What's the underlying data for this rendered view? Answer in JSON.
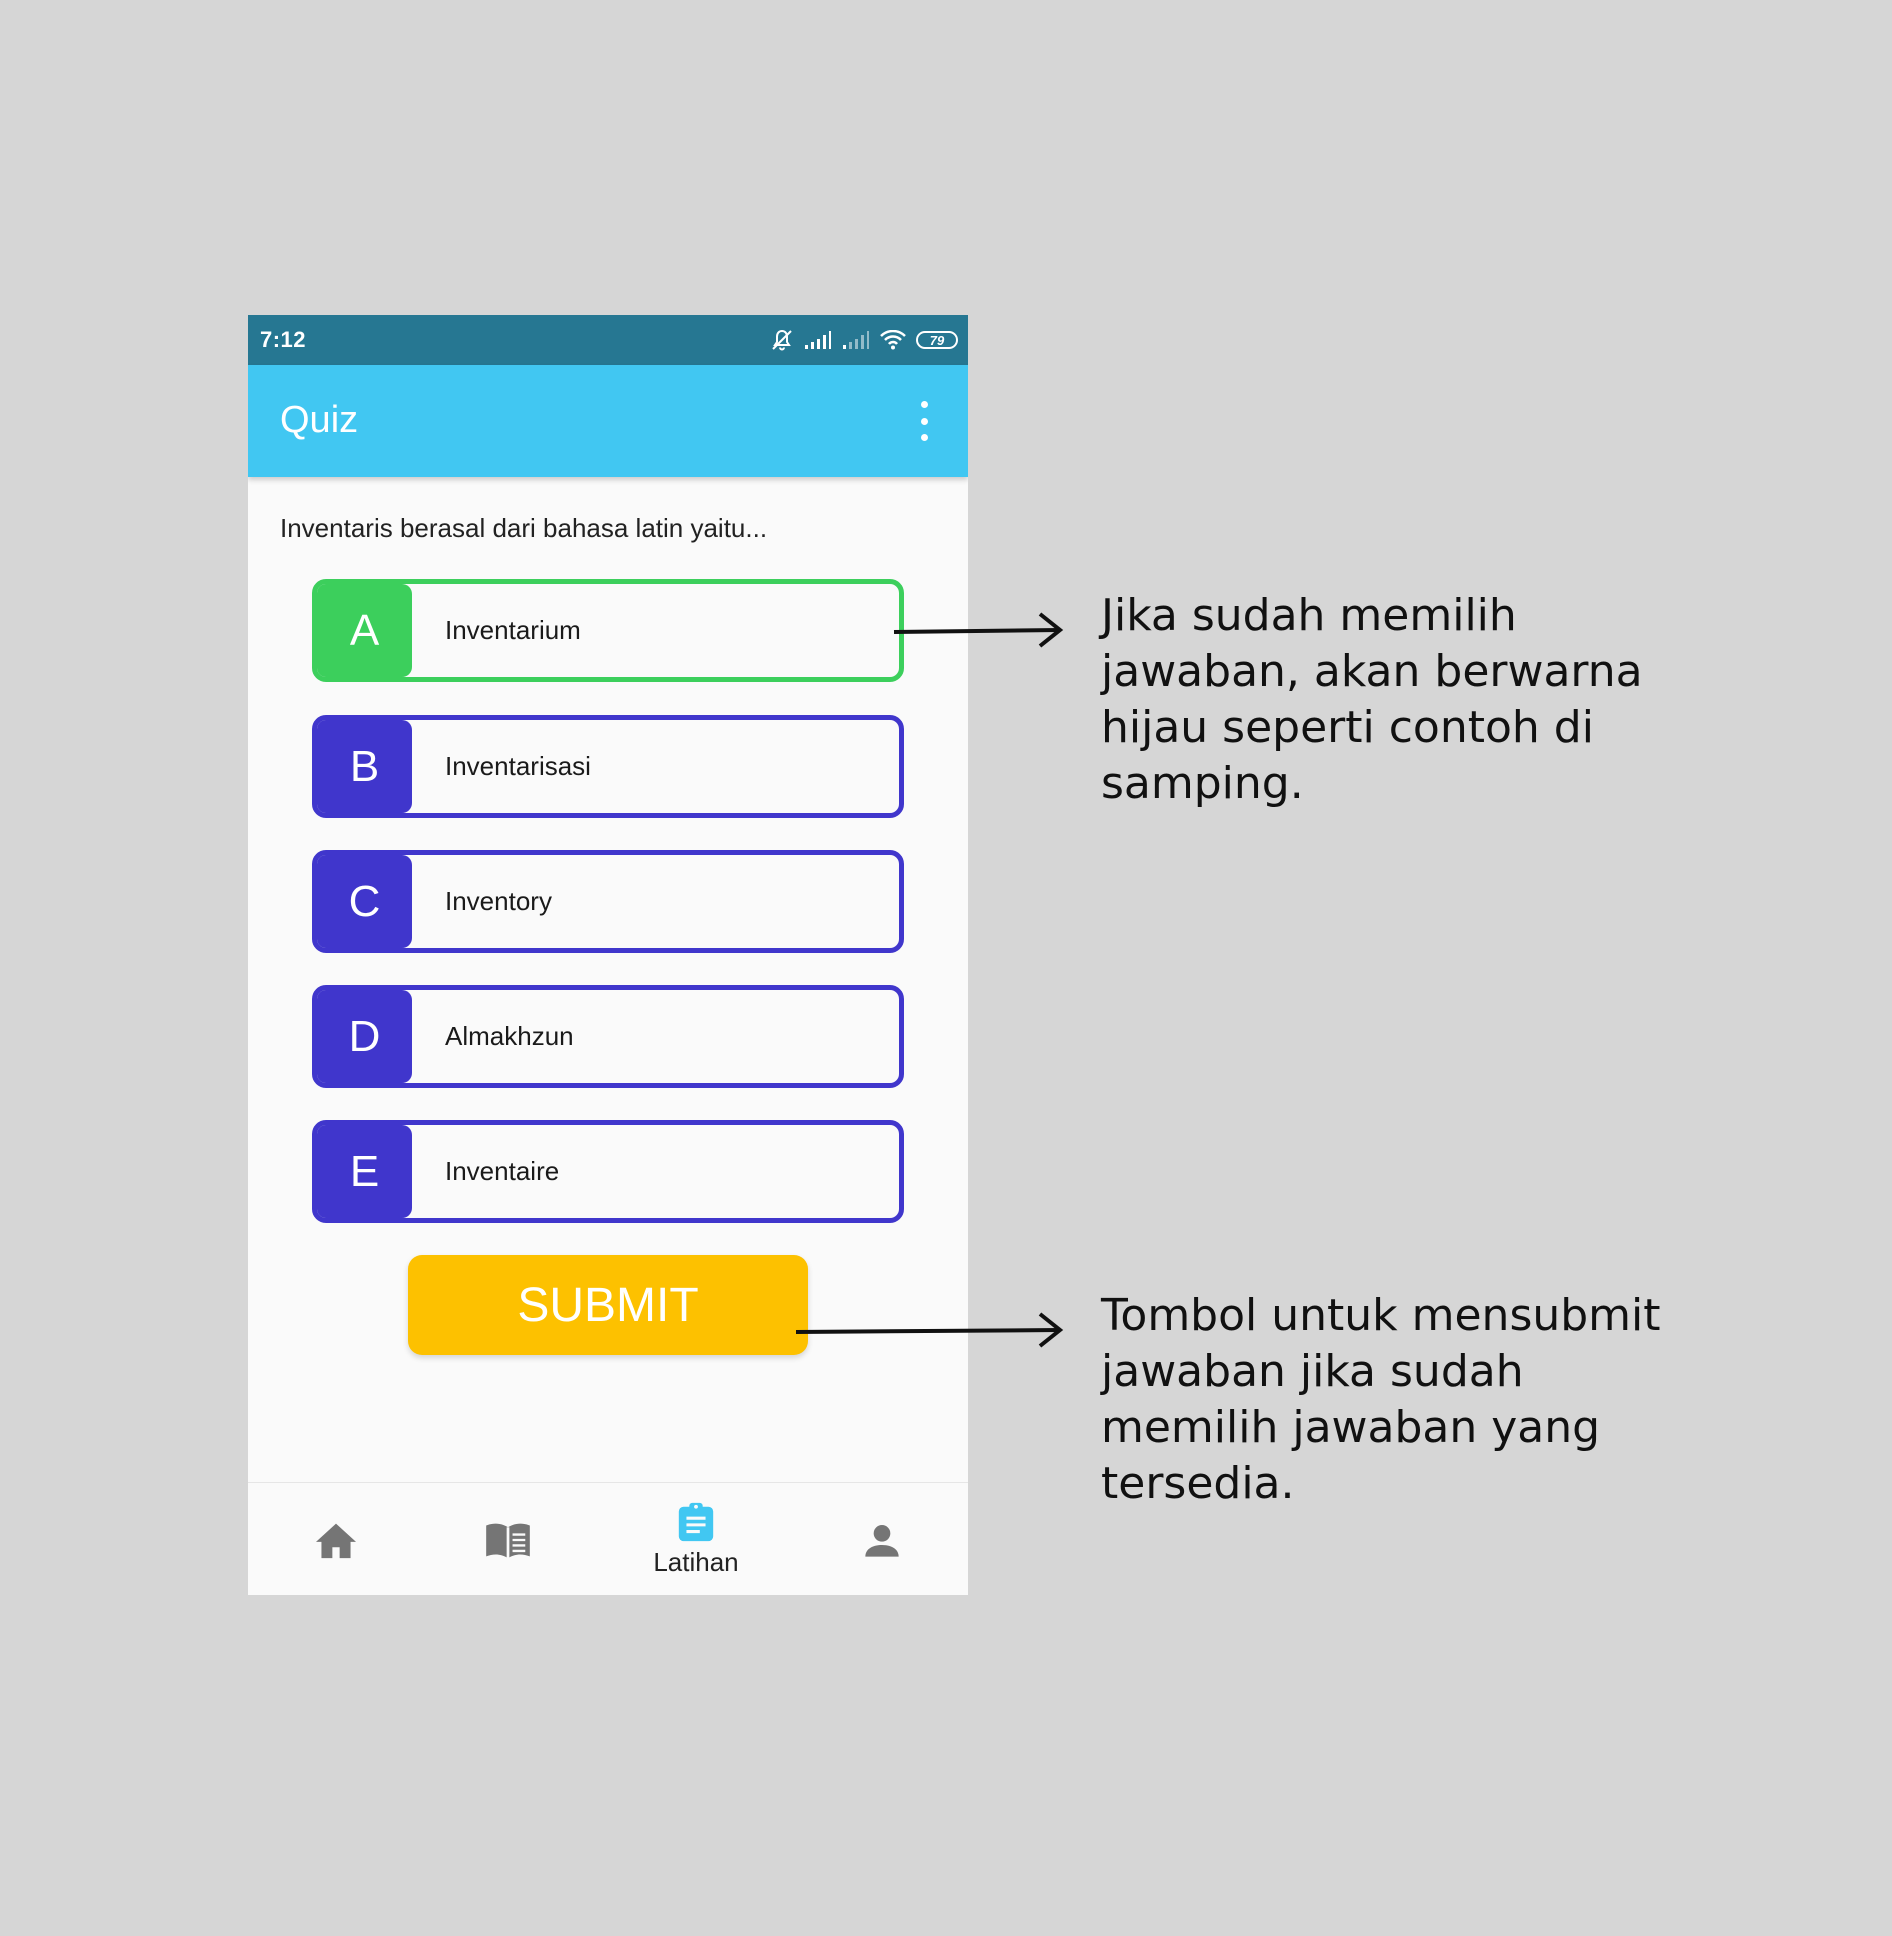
{
  "status_bar": {
    "time": "7:12",
    "battery": "79"
  },
  "app_bar": {
    "title": "Quiz"
  },
  "quiz": {
    "question": "Inventaris berasal dari bahasa latin yaitu...",
    "selected_index": 0,
    "options": [
      {
        "letter": "A",
        "text": "Inventarium"
      },
      {
        "letter": "B",
        "text": "Inventarisasi"
      },
      {
        "letter": "C",
        "text": "Inventory"
      },
      {
        "letter": "D",
        "text": "Almakhzun"
      },
      {
        "letter": "E",
        "text": "Inventaire"
      }
    ],
    "submit_label": "SUBMIT"
  },
  "bottom_nav": {
    "active_label": "Latihan"
  },
  "annotations": {
    "selected_note": "Jika sudah memilih jawaban, akan berwarna hijau seperti contoh di samping.",
    "submit_note": "Tombol untuk mensubmit jawaban jika sudah memilih jawaban yang tersedia."
  },
  "colors": {
    "status_bar": "#267792",
    "app_bar": "#41c7f2",
    "option_default": "#4036cc",
    "option_selected": "#3ccf5c",
    "submit": "#fdc100",
    "nav_active": "#41c7f2"
  }
}
